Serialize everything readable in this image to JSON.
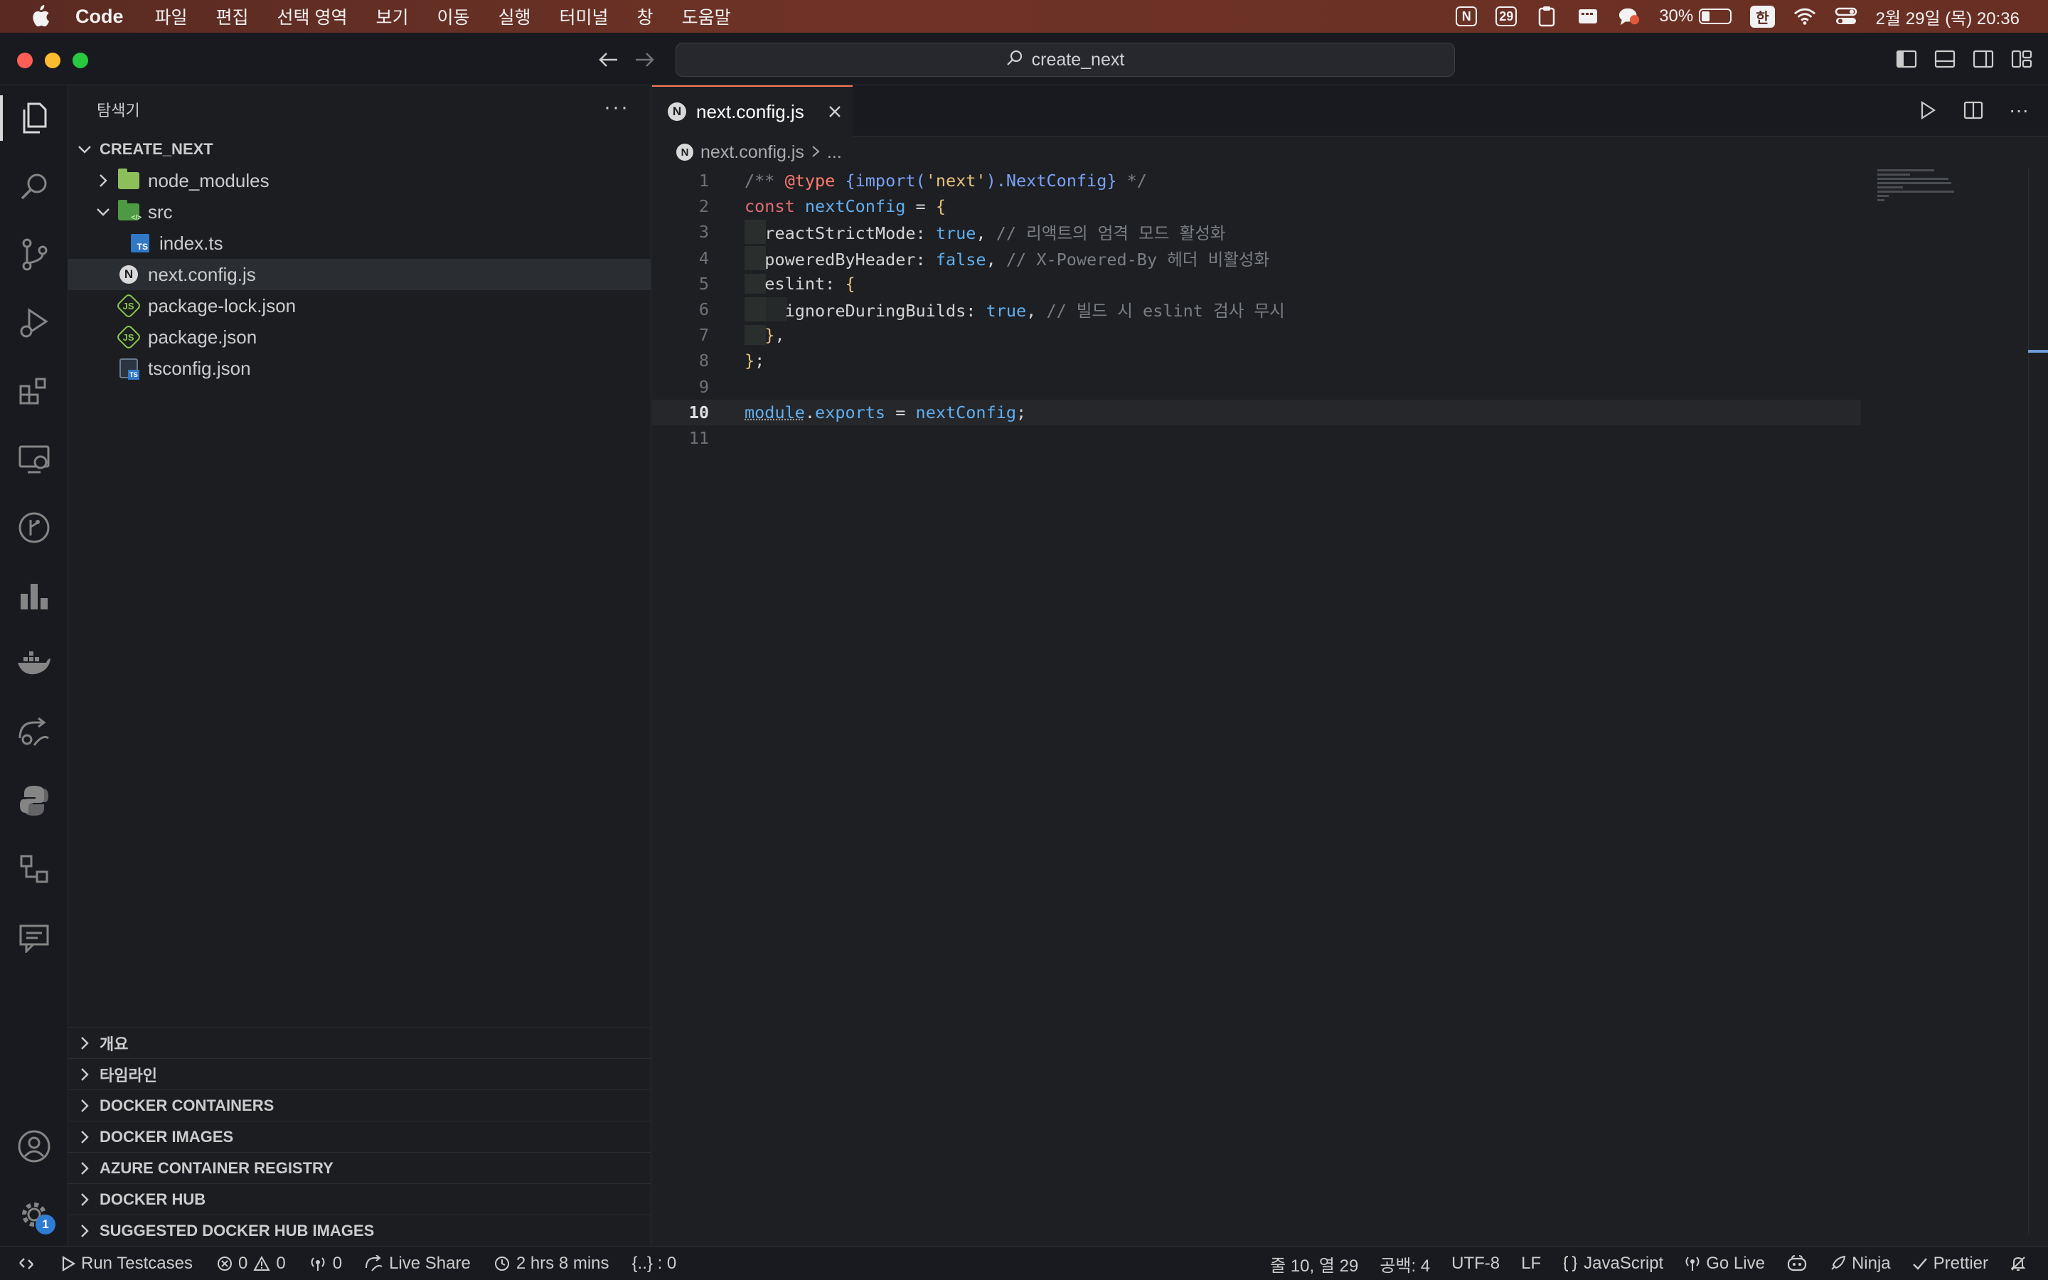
{
  "menubar": {
    "app_name": "Code",
    "items": [
      "파일",
      "편집",
      "선택 영역",
      "보기",
      "이동",
      "실행",
      "터미널",
      "창",
      "도움말"
    ],
    "calendar_day": "29",
    "notion_label": "N",
    "battery_percent": "30%",
    "battery_level": 0.3,
    "input_method": "한",
    "datetime": "2월 29일 (목) 20:36"
  },
  "titlebar": {
    "search_text": "create_next"
  },
  "activitybar": {
    "settings_badge": "1"
  },
  "sidebar": {
    "title": "탐색기",
    "root": "CREATE_NEXT",
    "tree": {
      "node_modules": "node_modules",
      "src": "src",
      "index_ts": "index.ts",
      "next_config": "next.config.js",
      "package_lock": "package-lock.json",
      "package_json": "package.json",
      "tsconfig": "tsconfig.json"
    },
    "panels": [
      "개요",
      "타임라인",
      "DOCKER CONTAINERS",
      "DOCKER IMAGES",
      "AZURE CONTAINER REGISTRY",
      "DOCKER HUB",
      "SUGGESTED DOCKER HUB IMAGES"
    ]
  },
  "editor": {
    "tab_label": "next.config.js",
    "breadcrumb_file": "next.config.js",
    "breadcrumb_more": "...",
    "line_numbers": [
      "1",
      "2",
      "3",
      "4",
      "5",
      "6",
      "7",
      "8",
      "9",
      "10",
      "11"
    ],
    "current_line": 10,
    "code": {
      "l1_comment_start": "/** ",
      "l1_tag": "@type",
      "l1_type_open": " {import(",
      "l1_string": "'next'",
      "l1_type_close": ").NextConfig}",
      "l1_comment_end": " */",
      "l2_kw": "const",
      "l2_var": " nextConfig",
      "l2_rest": " = ",
      "l2_brace": "{",
      "l3_prop": "reactStrictMode: ",
      "l3_val": "true",
      "l3_punc": ", ",
      "l3_comment": "// 리액트의 엄격 모드 활성화",
      "l4_prop": "poweredByHeader: ",
      "l4_val": "false",
      "l4_punc": ", ",
      "l4_comment": "// X-Powered-By 헤더 비활성화",
      "l5_prop": "eslint: ",
      "l5_brace": "{",
      "l6_prop": "ignoreDuringBuilds: ",
      "l6_val": "true",
      "l6_punc": ", ",
      "l6_comment": "// 빌드 시 eslint 검사 무시",
      "l7_brace": "}",
      "l7_punc": ",",
      "l8_brace": "}",
      "l8_punc": ";",
      "l10_module": "module",
      "l10_dot": ".",
      "l10_exports": "exports",
      "l10_eq": " = ",
      "l10_var": "nextConfig",
      "l10_semi": ";"
    }
  },
  "statusbar": {
    "run_testcases": "Run Testcases",
    "errors": "0",
    "warnings": "0",
    "ports": "0",
    "live_share": "Live Share",
    "time": "2 hrs 8 mins",
    "json_count": "{..} : 0",
    "cursor_pos": "줄 10, 열 29",
    "spaces": "공백: 4",
    "encoding": "UTF-8",
    "eol": "LF",
    "language": "JavaScript",
    "go_live": "Go Live",
    "ninja": "Ninja",
    "prettier": "Prettier"
  }
}
